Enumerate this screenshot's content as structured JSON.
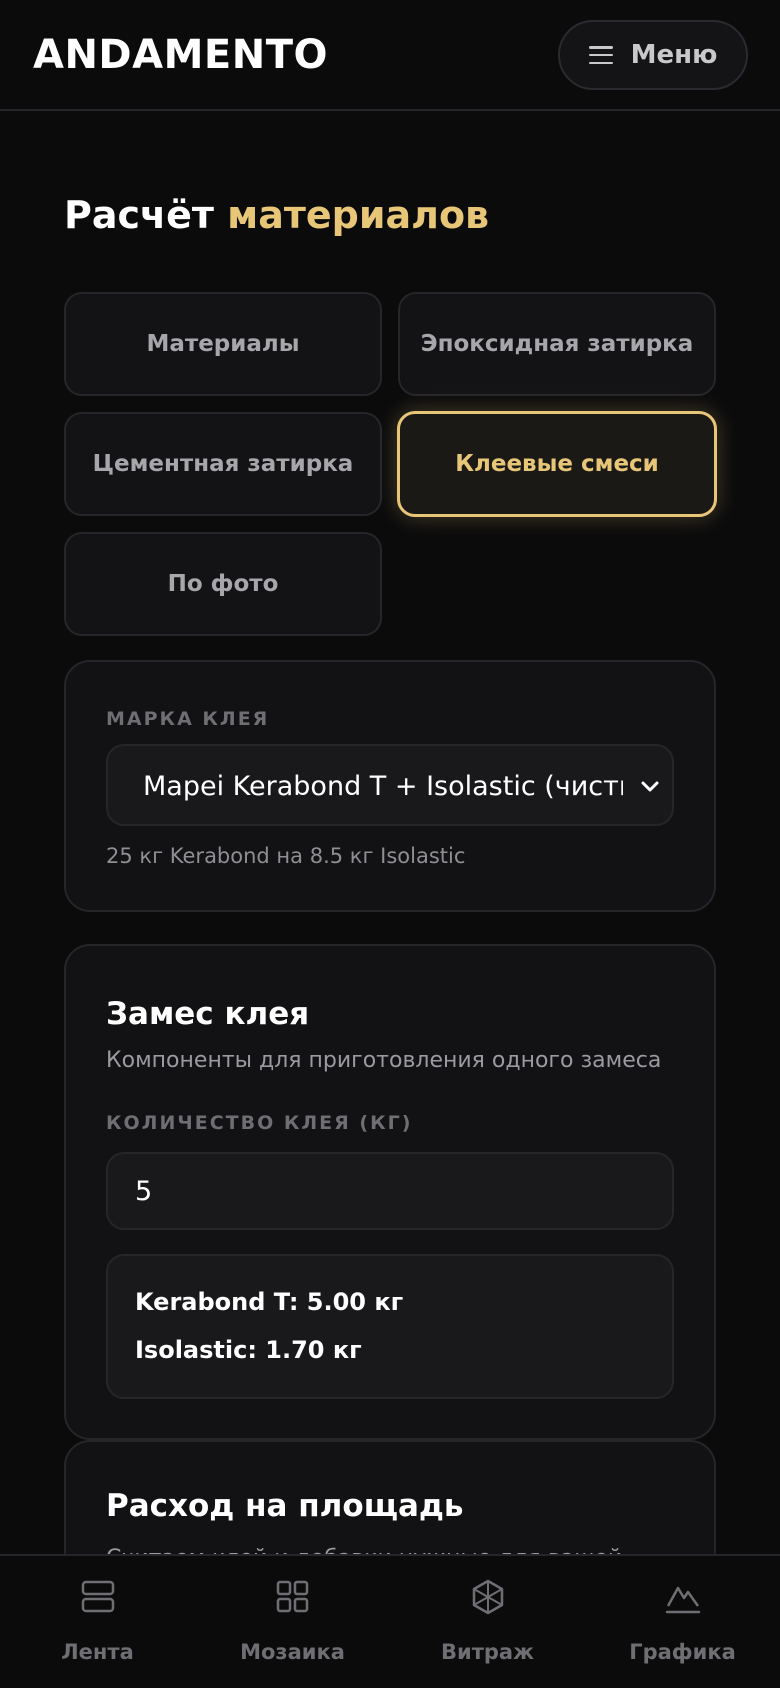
{
  "header": {
    "logo": "ANDAMENTO",
    "menu_label": "Меню"
  },
  "page": {
    "title_main": "Расчёт",
    "title_accent": "материалов"
  },
  "tabs": [
    {
      "label": "Материалы",
      "active": false
    },
    {
      "label": "Эпоксидная затирка",
      "active": false
    },
    {
      "label": "Цементная затирка",
      "active": false
    },
    {
      "label": "Клеевые смеси",
      "active": true
    },
    {
      "label": "По фото",
      "active": false
    }
  ],
  "brand_card": {
    "label": "МАРКА КЛЕЯ",
    "selected": "Mapei Kerabond T + Isolastic (чисты",
    "hint": "25 кг Kerabond на 8.5 кг Isolastic"
  },
  "mix_card": {
    "title": "Замес клея",
    "subtitle": "Компоненты для приготовления одного замеса",
    "qty_label": "КОЛИЧЕСТВО КЛЕЯ (КГ)",
    "qty_value": "5",
    "results": [
      "Kerabond T: 5.00 кг",
      "Isolastic: 1.70 кг"
    ]
  },
  "area_card": {
    "title": "Расход на площадь",
    "subtitle": "Считаем клей и добавки нужные для вашей"
  },
  "bottom_nav": [
    {
      "label": "Лента",
      "icon": "feed-icon"
    },
    {
      "label": "Мозаика",
      "icon": "grid-icon"
    },
    {
      "label": "Витраж",
      "icon": "stained-glass-icon"
    },
    {
      "label": "Графика",
      "icon": "mountain-icon"
    }
  ],
  "colors": {
    "accent": "#e8c678",
    "background": "#0b0b0c",
    "card": "#121214"
  }
}
